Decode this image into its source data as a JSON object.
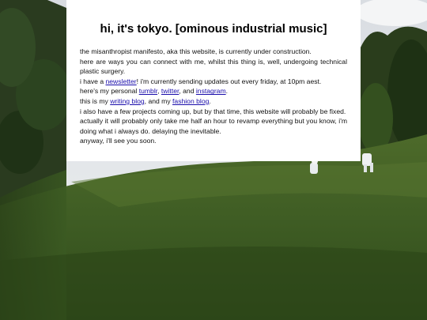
{
  "title": "hi, it's tokyo. [ominous industrial music]",
  "lines": {
    "l1": "the misanthropist manifesto, aka this website, is currently under construction.",
    "l2": "here are ways you can connect with me, whilst this thing is, well, undergoing technical plastic surgery.",
    "l3_pre": "i have a ",
    "l3_link": "newsletter",
    "l3_post": "! i'm currently sending updates out every friday, at 10pm aest.",
    "l4_pre": "here's my personal ",
    "l4_link1": "tumblr",
    "l4_sep": ", ",
    "l4_link2": "twitter",
    "l4_and": ", and ",
    "l4_link3": "instagram",
    "l4_end": ".",
    "l5_pre": "this is my ",
    "l5_link1": "writing blog",
    "l5_mid": ", and my ",
    "l5_link2": "fashion blog",
    "l5_end": ".",
    "l6": "i also have a few projects coming up, but by that time, this website will probably be fixed.",
    "l7": "actually it will probably only take me half an hour to revamp everything but you know, i'm doing what i always do. delaying the inevitable.",
    "l8": "anyway, i'll see you soon."
  },
  "colors": {
    "link": "#1a0dab",
    "card": "#ffffff"
  }
}
